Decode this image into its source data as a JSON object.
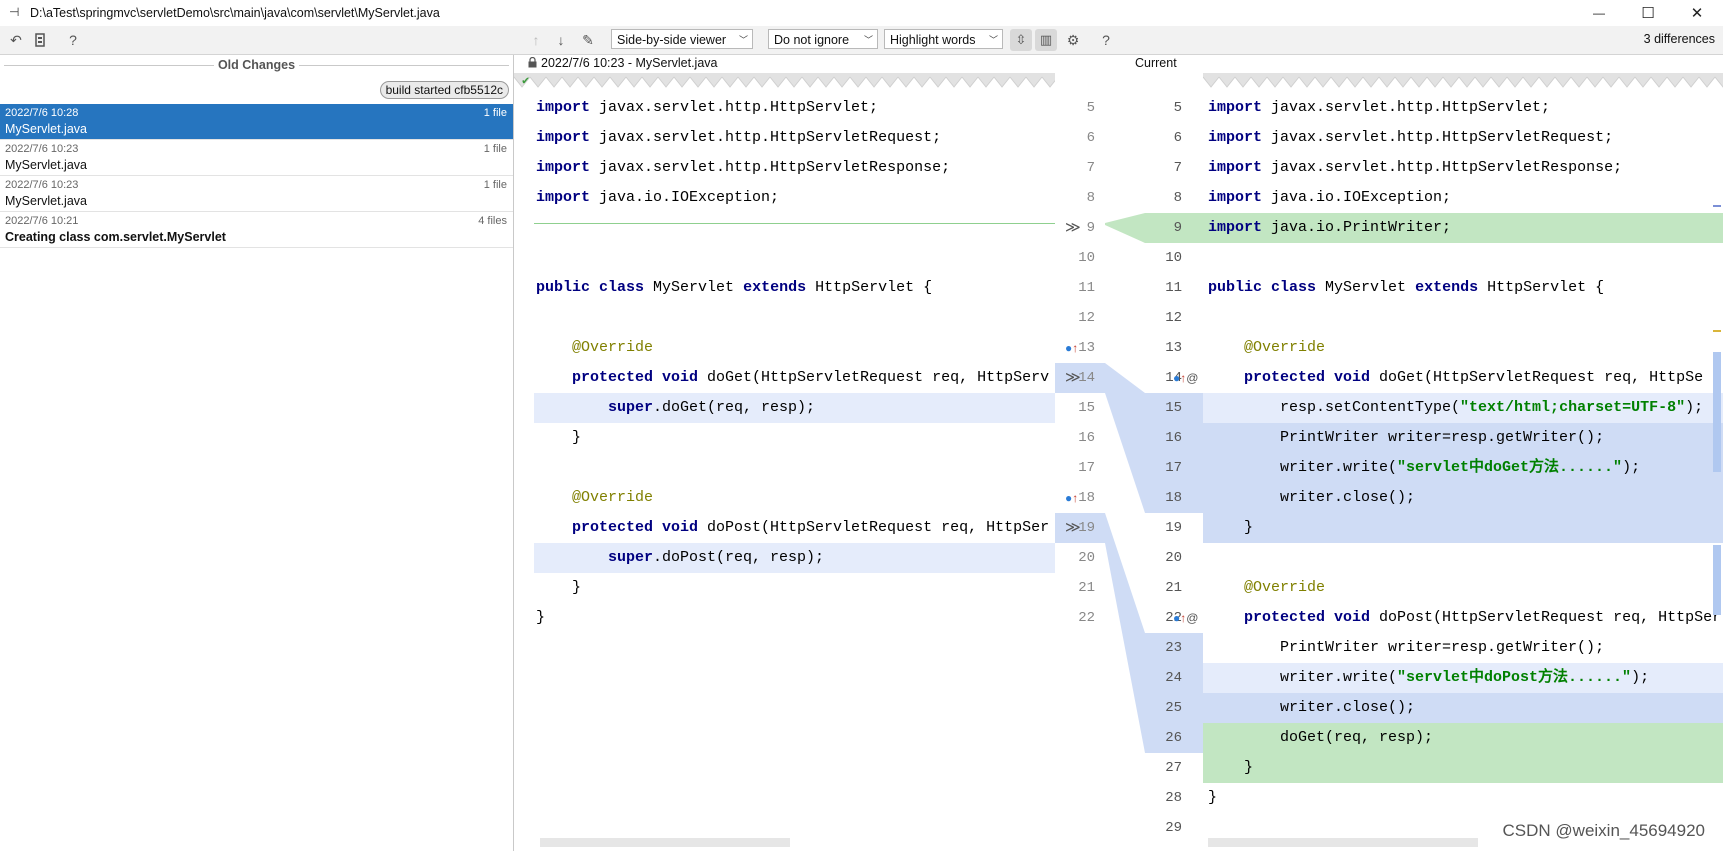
{
  "window": {
    "title": "D:\\aTest\\springmvc\\servletDemo\\src\\main\\java\\com\\servlet\\MyServlet.java",
    "minimize_glyph": "—",
    "maximize_glyph": "☐",
    "close_glyph": "✕"
  },
  "toolbar": {
    "viewer_mode": "Side-by-side viewer",
    "whitespace": "Do not ignore",
    "highlight": "Highlight words",
    "help": "?",
    "differences": "3 differences"
  },
  "left_panel": {
    "title": "Old Changes",
    "badge": "build started cfb5512c",
    "help": "?",
    "items": [
      {
        "date": "2022/7/6 10:28",
        "count": "1 file",
        "name": "MyServlet.java",
        "selected": true
      },
      {
        "date": "2022/7/6 10:23",
        "count": "1 file",
        "name": "MyServlet.java",
        "selected": false
      },
      {
        "date": "2022/7/6 10:23",
        "count": "1 file",
        "name": "MyServlet.java",
        "selected": false
      },
      {
        "date": "2022/7/6 10:21",
        "count": "4 files",
        "name": "Creating class com.servlet.MyServlet",
        "selected": false
      }
    ]
  },
  "diff": {
    "old_label": "2022/7/6 10:23 - MyServlet.java",
    "current_label": "Current",
    "left_numbers": [
      "5",
      "6",
      "7",
      "8",
      "9",
      "10",
      "11",
      "12",
      "13",
      "14",
      "15",
      "16",
      "17",
      "18",
      "19",
      "20",
      "21",
      "22"
    ],
    "right_numbers": [
      "5",
      "6",
      "7",
      "8",
      "9",
      "10",
      "11",
      "12",
      "13",
      "14",
      "15",
      "16",
      "17",
      "18",
      "19",
      "20",
      "21",
      "22",
      "23",
      "24",
      "25",
      "26",
      "27",
      "28",
      "29"
    ],
    "left_code": [
      {
        "k": "import",
        "t": " javax.servlet.http.HttpServlet;"
      },
      {
        "k": "import",
        "t": " javax.servlet.http.HttpServletRequest;"
      },
      {
        "k": "import",
        "t": " javax.servlet.http.HttpServletResponse;"
      },
      {
        "k": "import",
        "t": " java.io.IOException;"
      },
      {
        "k": "",
        "t": ""
      },
      {
        "k": "public class",
        "t": " MyServlet ",
        "k2": "extends",
        "t2": " HttpServlet {"
      },
      {
        "k": "",
        "t": ""
      },
      {
        "a": "    @Override"
      },
      {
        "k": "    protected void",
        "t": " doGet(HttpServletRequest req, HttpServ"
      },
      {
        "k": "        super",
        "t": ".doGet(req, resp);"
      },
      {
        "k": "",
        "t": "    }"
      },
      {
        "k": "",
        "t": ""
      },
      {
        "a": "    @Override"
      },
      {
        "k": "    protected void",
        "t": " doPost(HttpServletRequest req, HttpSer"
      },
      {
        "k": "        super",
        "t": ".doPost(req, resp);"
      },
      {
        "k": "",
        "t": "    }"
      },
      {
        "k": "",
        "t": "}"
      }
    ],
    "right_code": [
      {
        "k": "import",
        "t": " javax.servlet.http.HttpServlet;"
      },
      {
        "k": "import",
        "t": " javax.servlet.http.HttpServletRequest;"
      },
      {
        "k": "import",
        "t": " javax.servlet.http.HttpServletResponse;"
      },
      {
        "k": "import",
        "t": " java.io.IOException;"
      },
      {
        "k": "import",
        "t": " java.io.PrintWriter;"
      },
      {
        "k": "",
        "t": ""
      },
      {
        "k": "public class",
        "t": " MyServlet ",
        "k2": "extends",
        "t2": " HttpServlet {"
      },
      {
        "k": "",
        "t": ""
      },
      {
        "a": "    @Override"
      },
      {
        "k": "    protected void",
        "t": " doGet(HttpServletRequest req, HttpSe"
      },
      {
        "k": "",
        "t": "        resp.setContentType(",
        "s": "\"text/html;charset=UTF-8\"",
        "t2": ");"
      },
      {
        "k": "",
        "t": "        PrintWriter writer=resp.getWriter();"
      },
      {
        "k": "",
        "t": "        writer.write(",
        "s": "\"servlet中doGet方法......\"",
        "t2": ");"
      },
      {
        "k": "",
        "t": "        writer.close();"
      },
      {
        "k": "",
        "t": "    }"
      },
      {
        "k": "",
        "t": ""
      },
      {
        "a": "    @Override"
      },
      {
        "k": "    protected void",
        "t": " doPost(HttpServletRequest req, HttpSer"
      },
      {
        "k": "",
        "t": "        PrintWriter writer=resp.getWriter();"
      },
      {
        "k": "",
        "t": "        writer.write(",
        "s": "\"servlet中doPost方法......\"",
        "t2": ");"
      },
      {
        "k": "",
        "t": "        writer.close();"
      },
      {
        "k": "",
        "t": "        doGet(req, resp);"
      },
      {
        "k": "",
        "t": "    }"
      },
      {
        "k": "",
        "t": "}"
      }
    ]
  },
  "watermark": "CSDN @weixin_45694920",
  "colors": {
    "selection": "#2675bf",
    "changed": "#cfdcf5",
    "added": "#c2e6c2",
    "keyword": "#000080",
    "annotation": "#808000",
    "string": "#008000"
  }
}
